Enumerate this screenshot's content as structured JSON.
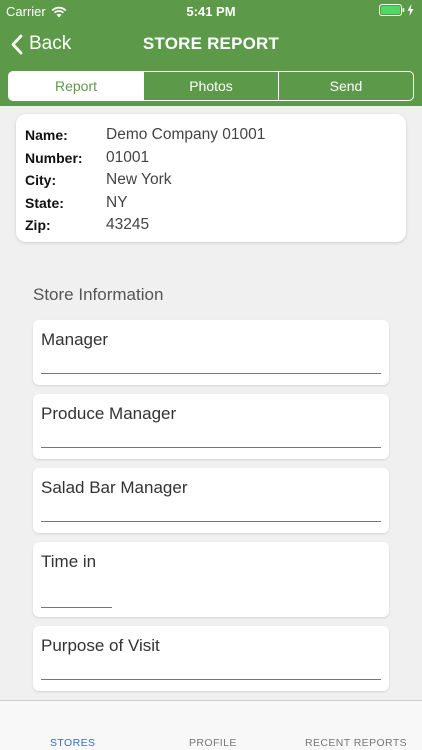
{
  "status_bar": {
    "carrier": "Carrier",
    "time": "5:41 PM"
  },
  "nav": {
    "back_label": "Back",
    "title": "STORE REPORT"
  },
  "segments": [
    "Report",
    "Photos",
    "Send"
  ],
  "store": [
    {
      "label": "Name:",
      "value": "Demo Company 01001"
    },
    {
      "label": "Number:",
      "value": "01001"
    },
    {
      "label": "City:",
      "value": "New York"
    },
    {
      "label": "State:",
      "value": "NY"
    },
    {
      "label": "Zip:",
      "value": "43245"
    }
  ],
  "section_title": "Store Information",
  "fields": [
    {
      "label": "Manager"
    },
    {
      "label": "Produce Manager"
    },
    {
      "label": "Salad Bar Manager"
    },
    {
      "label": "Time in"
    },
    {
      "label": "Purpose of Visit"
    }
  ],
  "tabs": [
    "STORES",
    "PROFILE",
    "RECENT REPORTS"
  ],
  "colors": {
    "brand_green": "#5c9a49",
    "tab_active": "#3b6fb6"
  }
}
